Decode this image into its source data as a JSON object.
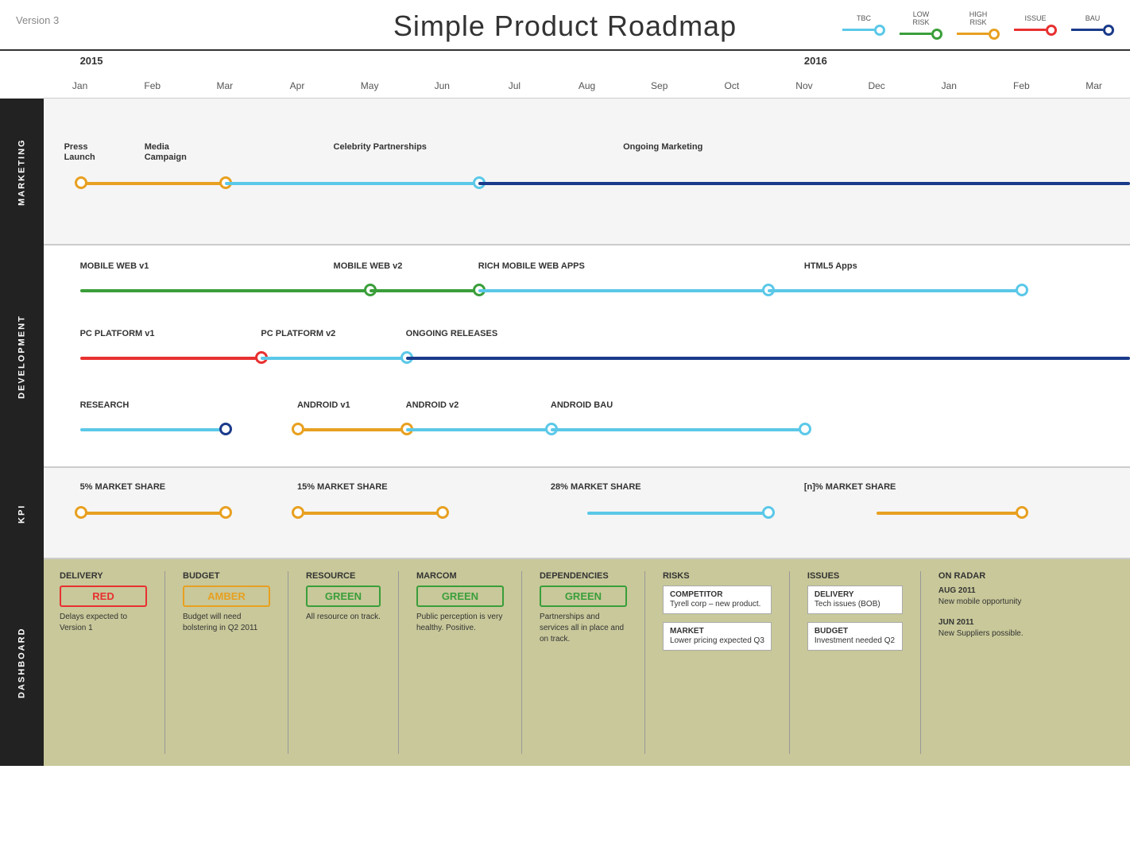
{
  "header": {
    "version": "Version 3",
    "title": "Simple Product Roadmap",
    "legend": [
      {
        "label": "TBC",
        "color": "#5bc8e8",
        "lineColor": "#5bc8e8"
      },
      {
        "label": "LOW\nRISK",
        "color": "#3a9e3a",
        "lineColor": "#3a9e3a"
      },
      {
        "label": "HIGH\nRISK",
        "color": "#e8a020",
        "lineColor": "#e8a020"
      },
      {
        "label": "ISSUE",
        "color": "#e83030",
        "lineColor": "#e83030"
      },
      {
        "label": "BAU",
        "color": "#1a3a8a",
        "lineColor": "#1a3a8a"
      }
    ]
  },
  "timeline": {
    "years": [
      {
        "label": "2015",
        "col": 1
      },
      {
        "label": "2016",
        "col": 11
      }
    ],
    "months": [
      "Jan",
      "Feb",
      "Mar",
      "Apr",
      "May",
      "Jun",
      "Jul",
      "Aug",
      "Sep",
      "Oct",
      "Nov",
      "Dec",
      "Jan",
      "Feb",
      "Mar"
    ]
  },
  "sections": {
    "marketing": "MARKETING",
    "development": "DEVELOPMENT",
    "kpi": "KPI",
    "dashboard": "DASHBOARD"
  },
  "dashboard": {
    "delivery": {
      "title": "DELIVERY",
      "badge_text": "RED",
      "badge_color": "#e83030",
      "text": "Delays expected to Version 1"
    },
    "budget": {
      "title": "BUDGET",
      "badge_text": "AMBER",
      "badge_color": "#e8a020",
      "text": "Budget will need bolstering in Q2 2011"
    },
    "resource": {
      "title": "RESOURCE",
      "badge_text": "GREEN",
      "badge_color": "#3a9e3a",
      "text": "All resource on track."
    },
    "marcom": {
      "title": "MARCOM",
      "badge_text": "GREEN",
      "badge_color": "#3a9e3a",
      "text": "Public perception is very healthy. Positive."
    },
    "dependencies": {
      "title": "DEPENDENCIES",
      "badge_text": "GREEN",
      "badge_color": "#3a9e3a",
      "text": "Partnerships and services all in place and on track."
    },
    "risks": {
      "title": "RISKS",
      "items": [
        {
          "title": "COMPETITOR",
          "text": "Tyrell corp – new product."
        },
        {
          "title": "MARKET",
          "text": "Lower pricing expected Q3"
        }
      ]
    },
    "issues": {
      "title": "ISSUES",
      "items": [
        {
          "title": "DELIVERY",
          "text": "Tech issues (BOB)"
        },
        {
          "title": "BUDGET",
          "text": "Investment needed Q2"
        }
      ]
    },
    "on_radar": {
      "title": "ON RADAR",
      "items": [
        {
          "date": "AUG 2011",
          "text": "New mobile opportunity"
        },
        {
          "date": "JUN 2011",
          "text": "New Suppliers possible."
        }
      ]
    }
  }
}
